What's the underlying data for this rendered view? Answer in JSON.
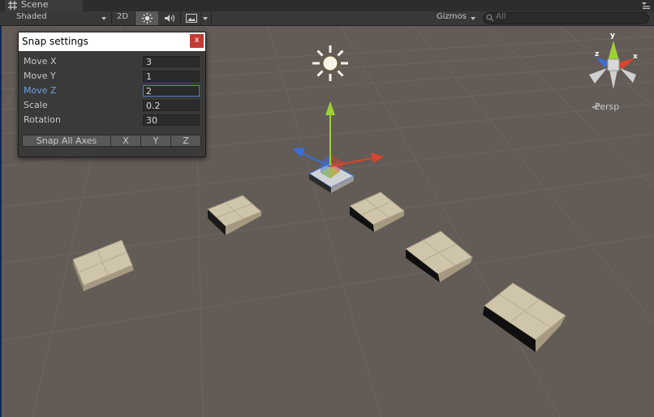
{
  "tab": {
    "title": "Scene",
    "icon": "scene-grid-icon"
  },
  "toolbar": {
    "shading_mode": "Shaded",
    "toggle_2d": "2D",
    "lighting_icon": "sun-icon",
    "audio_icon": "speaker-icon",
    "effects_icon": "image-icon",
    "gizmos_label": "Gizmos",
    "search_placeholder": "All"
  },
  "snap_window": {
    "title": "Snap settings",
    "close_label": "x",
    "rows": [
      {
        "label": "Move X",
        "value": "3"
      },
      {
        "label": "Move Y",
        "value": "1"
      },
      {
        "label": "Move Z",
        "value": "2"
      },
      {
        "label": "Scale",
        "value": "0.2"
      },
      {
        "label": "Rotation",
        "value": "30"
      }
    ],
    "buttons": {
      "snap_all": "Snap All Axes",
      "x": "X",
      "y": "Y",
      "z": "Z"
    }
  },
  "orientation_gizmo": {
    "y_label": "y",
    "x_label": "x",
    "z_label": "z",
    "projection": "Persp"
  },
  "colors": {
    "scene_background": "#625b56",
    "axis_x": "#d8442c",
    "axis_y": "#9ed033",
    "axis_z": "#3b6fd6",
    "tile_top": "#cfc5aa",
    "focus_blue": "#4d7bd0"
  }
}
